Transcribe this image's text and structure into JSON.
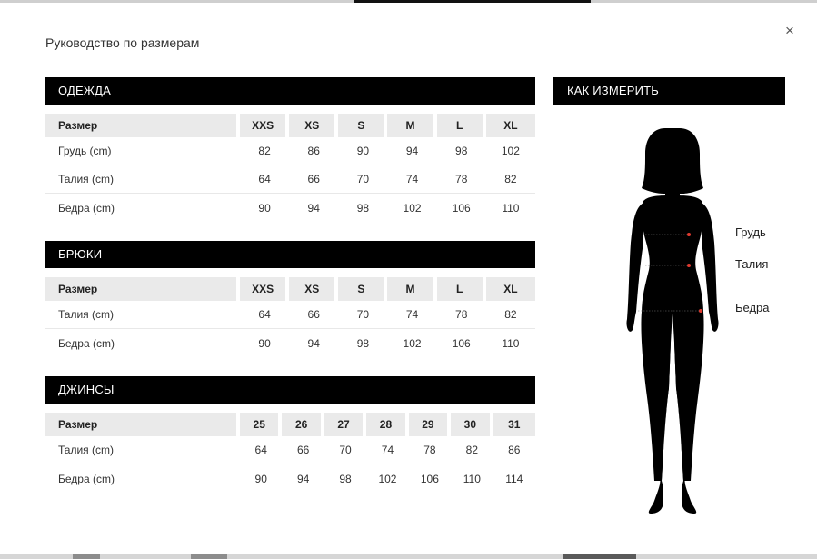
{
  "modal": {
    "title": "Руководство по размерам",
    "close_label": "×"
  },
  "clothing": {
    "title": "ОДЕЖДА",
    "header": [
      "Размер",
      "XXS",
      "XS",
      "S",
      "M",
      "L",
      "XL"
    ],
    "rows": [
      {
        "label": "Грудь (cm)",
        "values": [
          "82",
          "86",
          "90",
          "94",
          "98",
          "102"
        ]
      },
      {
        "label": "Талия (cm)",
        "values": [
          "64",
          "66",
          "70",
          "74",
          "78",
          "82"
        ]
      },
      {
        "label": "Бедра (cm)",
        "values": [
          "90",
          "94",
          "98",
          "102",
          "106",
          "110"
        ]
      }
    ]
  },
  "trousers": {
    "title": "БРЮКИ",
    "header": [
      "Размер",
      "XXS",
      "XS",
      "S",
      "M",
      "L",
      "XL"
    ],
    "rows": [
      {
        "label": "Талия (cm)",
        "values": [
          "64",
          "66",
          "70",
          "74",
          "78",
          "82"
        ]
      },
      {
        "label": "Бедра (cm)",
        "values": [
          "90",
          "94",
          "98",
          "102",
          "106",
          "110"
        ]
      }
    ]
  },
  "jeans": {
    "title": "ДЖИНСЫ",
    "header": [
      "Размер",
      "25",
      "26",
      "27",
      "28",
      "29",
      "30",
      "31"
    ],
    "rows": [
      {
        "label": "Талия (cm)",
        "values": [
          "64",
          "66",
          "70",
          "74",
          "78",
          "82",
          "86"
        ]
      },
      {
        "label": "Бедра (cm)",
        "values": [
          "90",
          "94",
          "98",
          "102",
          "106",
          "110",
          "114"
        ]
      }
    ]
  },
  "how_to_measure": {
    "title": "КАК ИЗМЕРИТЬ",
    "labels": {
      "chest": "Грудь",
      "waist": "Талия",
      "hips": "Бедра"
    },
    "figure_icon": "female-silhouette-icon",
    "marker_color": "#e03a2f"
  }
}
